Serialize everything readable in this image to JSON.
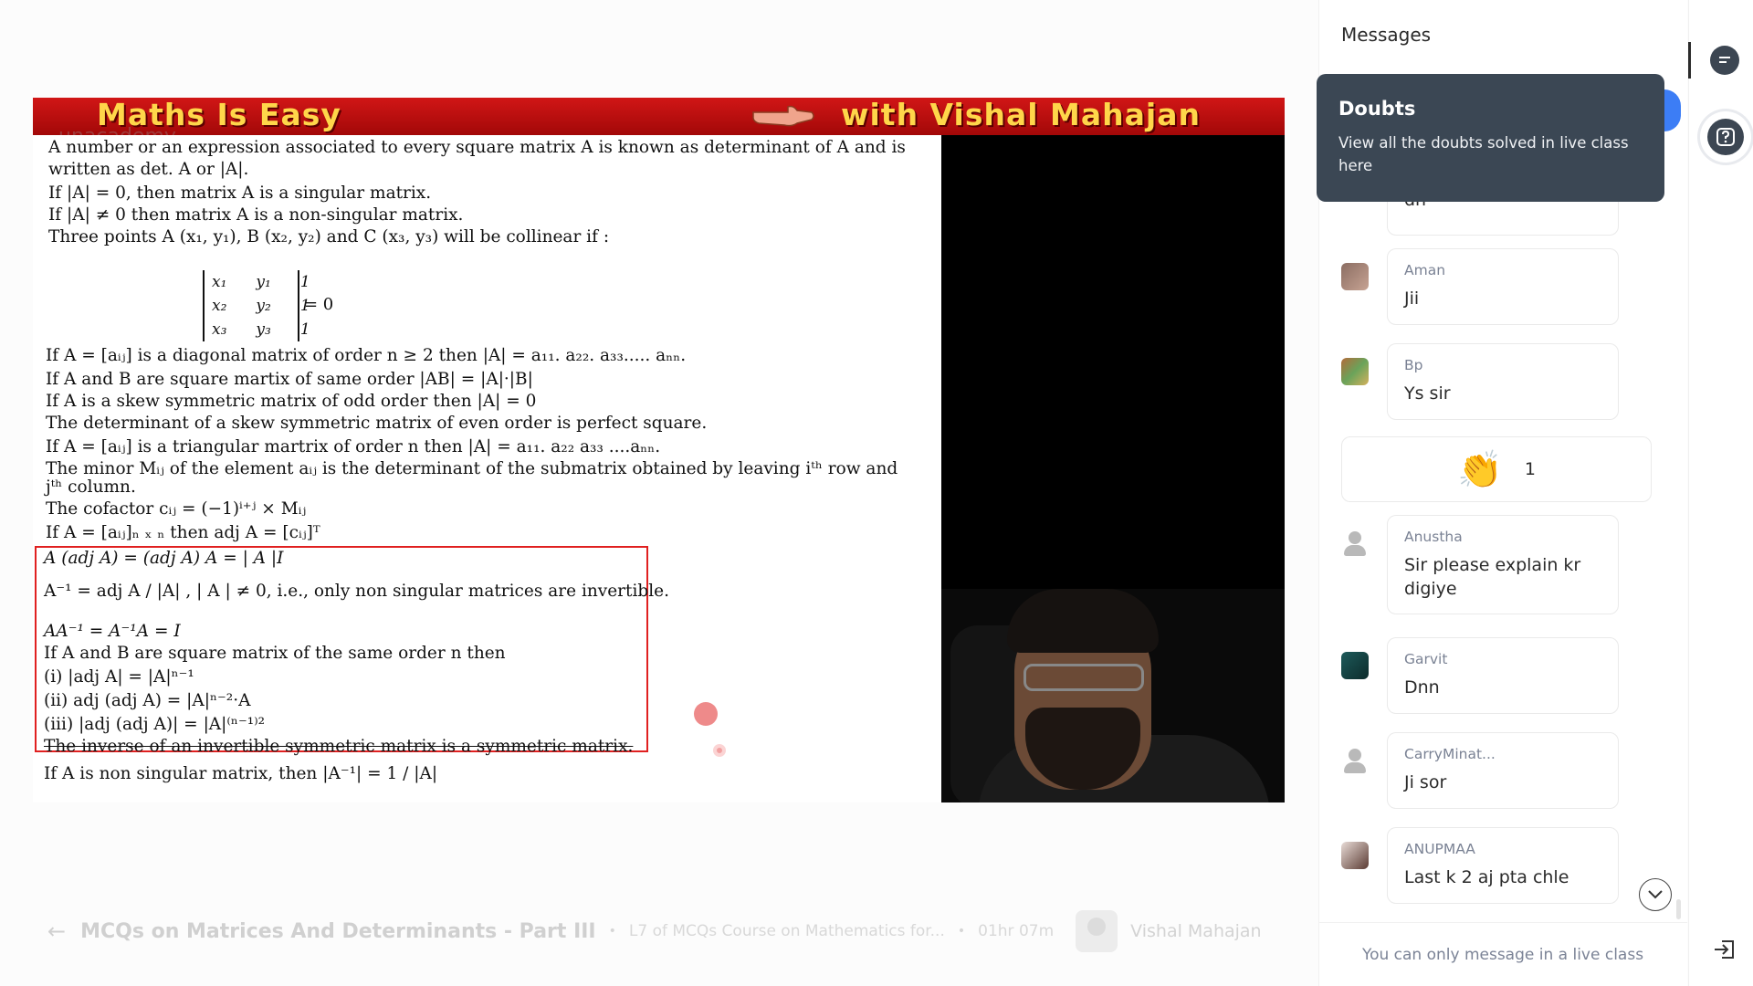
{
  "video": {
    "banner_left": "Maths Is Easy",
    "banner_right": "with Vishal Mahajan",
    "watermark": "unacademy",
    "slide_lines": [
      "A number or an expression associated to every square matrix A is known as determinant of A and is",
      "written as det. A or |A|.",
      "If |A| = 0, then matrix A is a singular matrix.",
      "If |A| ≠ 0 then matrix A is a non-singular matrix.",
      "Three points A (x₁, y₁), B (x₂, y₂) and C (x₃, y₃) will be collinear if :",
      "If A = [aᵢⱼ] is a diagonal matrix of order n ≥ 2 then |A| = a₁₁. a₂₂. a₃₃..... aₙₙ.",
      "If A and B are square martix of same order |AB| = |A|·|B|",
      "If A is a skew symmetric matrix of odd order then |A| = 0",
      "The determinant of a skew symmetric matrix of even order is  perfect square.",
      "If A = [aᵢⱼ]  is a triangular martrix  of order n then |A| = a₁₁. a₂₂ a₃₃ ....aₙₙ.",
      "The minor Mᵢⱼ of the element aᵢⱼ is the determinant of the submatrix obtained by leaving iᵗʰ row and",
      "jᵗʰ column.",
      "The cofactor cᵢⱼ = (−1)ⁱ⁺ʲ  × Mᵢⱼ",
      "If A = [aᵢⱼ]ₙ ₓ ₙ then  adj A = [cᵢⱼ]ᵀ",
      "A (adj A) = (adj A) A = | A |I",
      "A⁻¹ = adj A / |A| , | A | ≠ 0, i.e.,  only non singular matrices are invertible.",
      "AA⁻¹ = A⁻¹A = I",
      "If A and B are square matrix of the same order n then",
      "(i) |adj A| = |A|ⁿ⁻¹",
      "(ii) adj (adj A) = |A|ⁿ⁻²·A",
      "(iii) |adj (adj A)| = |A|⁽ⁿ⁻¹⁾²",
      "The inverse of an invertible symmetric matrix is a symmetric matrix.",
      "If A is non singular matrix, then |A⁻¹| = 1 / |A|"
    ],
    "determinant": {
      "rows": [
        [
          "x₁",
          "y₁",
          "1"
        ],
        [
          "x₂",
          "y₂",
          "1"
        ],
        [
          "x₃",
          "y₃",
          "1"
        ]
      ],
      "equals": "= 0"
    }
  },
  "info_bar": {
    "back_icon": "arrow-left-icon",
    "course_title": "MCQs on Matrices And Determinants - Part III",
    "lesson": "L7 of MCQs Course on Mathematics for...",
    "duration": "01hr 07m",
    "educator_name": "Vishal Mahajan"
  },
  "chat": {
    "title": "Messages",
    "tooltip": {
      "title": "Doubts",
      "description": "View all the doubts solved in live class here"
    },
    "partial_message": "dn",
    "messages": [
      {
        "user": "Aman",
        "text": "Jii"
      },
      {
        "user": "Bp",
        "text": "Ys sir"
      },
      {
        "user": "Anustha",
        "text": "Sir please explain kr digiye"
      },
      {
        "user": "Garvit",
        "text": "Dnn"
      },
      {
        "user": "CarryMinat...",
        "text": "Ji sor"
      },
      {
        "user": "ANUPMAA",
        "text": "Last k 2 aj pta chle"
      }
    ],
    "reaction": {
      "emoji": "clapping-hands",
      "count": "1"
    },
    "footer": "You can only message in a live class"
  },
  "colors": {
    "banner_red": "#c40e0e",
    "banner_text": "#ffd64a",
    "highlight_box": "#e02020",
    "tooltip_bg": "#3b4754",
    "accent_blue": "#3c7df5"
  }
}
